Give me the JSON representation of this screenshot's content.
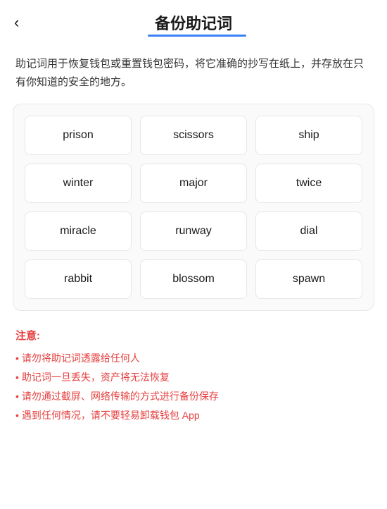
{
  "header": {
    "back_label": "‹",
    "title": "备份助记词",
    "title_underline_color": "#3b82f6"
  },
  "description": {
    "text": "助记词用于恢复钱包或重置钱包密码，将它准确的抄写在纸上，并存放在只有你知道的安全的地方。"
  },
  "mnemonic": {
    "words": [
      "prison",
      "scissors",
      "ship",
      "winter",
      "major",
      "twice",
      "miracle",
      "runway",
      "dial",
      "rabbit",
      "blossom",
      "spawn"
    ]
  },
  "notice": {
    "title": "注意:",
    "items": [
      "请勿将助记词透露给任何人",
      "助记词一旦丢失，资产将无法恢复",
      "请勿通过截屏、网络传输的方式进行备份保存",
      "遇到任何情况，请不要轻易卸载钱包 App"
    ]
  }
}
